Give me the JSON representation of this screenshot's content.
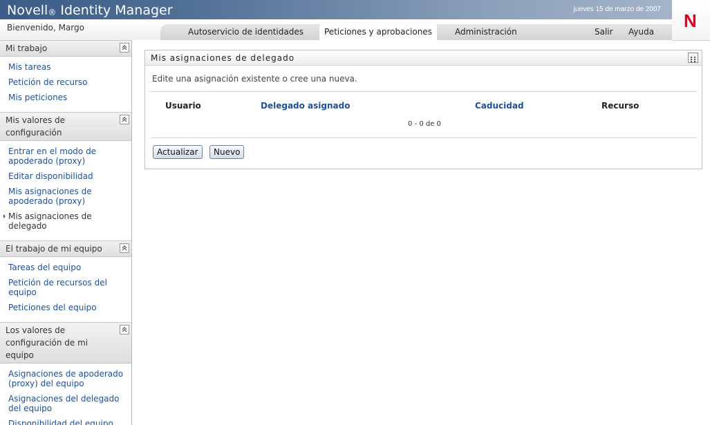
{
  "header": {
    "brand": "Novell",
    "brand_mark": "®",
    "product": "Identity Manager",
    "date": "jueves 15 de marzo de 2007",
    "welcome": "Bienvenido, Margo",
    "logo_letter": "N",
    "tabs": [
      {
        "label": "Autoservicio de identidades"
      },
      {
        "label": "Peticiones y aprobaciones"
      },
      {
        "label": "Administración"
      }
    ],
    "logout": "Salir",
    "help": "Ayuda",
    "colors": {
      "accent": "#3a5c86",
      "logo": "#e2001a"
    }
  },
  "sidebar": {
    "sections": [
      {
        "title": "Mi trabajo",
        "items": [
          "Mis tareas",
          "Petición de recurso",
          "Mis peticiones"
        ]
      },
      {
        "title": "Mis valores de configuración",
        "items": [
          "Entrar en el modo de apoderado (proxy)",
          "Editar disponibilidad",
          "Mis asignaciones de apoderado (proxy)",
          "Mis asignaciones de delegado"
        ]
      },
      {
        "title": "El trabajo de mi equipo",
        "items": [
          "Tareas del equipo",
          "Petición de recursos del equipo",
          "Peticiones del equipo"
        ]
      },
      {
        "title": "Los valores de configuración de mi equipo",
        "items": [
          "Asignaciones de apoderado (proxy) del equipo",
          "Asignaciones del delegado del equipo",
          "Disponibilidad del equipo"
        ]
      }
    ]
  },
  "main": {
    "title": "Mis asignaciones de delegado",
    "description": "Edite una asignación existente o cree una nueva.",
    "columns": [
      "Usuario",
      "Delegado asignado",
      "Caducidad",
      "Recurso"
    ],
    "pager": "0 - 0 de 0",
    "buttons": {
      "refresh": "Actualizar",
      "new": "Nuevo"
    }
  },
  "icons": [
    "collapse-icon",
    "panel-menu-icon",
    "novell-logo-icon"
  ]
}
